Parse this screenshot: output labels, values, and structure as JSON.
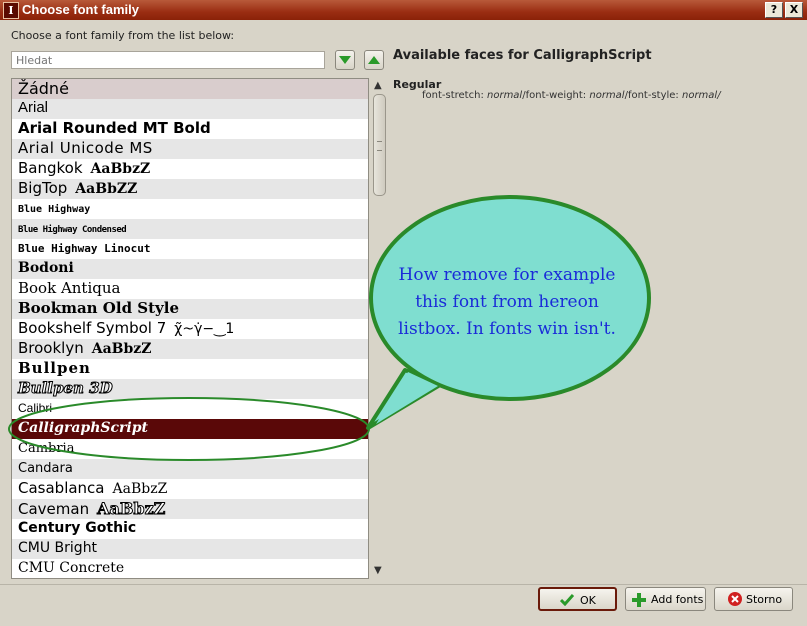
{
  "window": {
    "title": "Choose font family",
    "help_button": "?",
    "close_button": "X"
  },
  "prompt": "Choose a font family from the list below:",
  "search": {
    "placeholder": "Hledat"
  },
  "faces": {
    "title": "Available faces for CalligraphScript",
    "items": [
      {
        "name": "Regular",
        "stretch_label": "font-stretch: ",
        "stretch": "normal",
        "weight_label": "/font-weight: ",
        "weight": "normal",
        "style_label": "/font-style: ",
        "style": "normal/"
      }
    ]
  },
  "font_list": [
    {
      "name": "Žádné",
      "sample": ""
    },
    {
      "name": "Arial",
      "sample": ""
    },
    {
      "name": "Arial Rounded MT Bold",
      "sample": ""
    },
    {
      "name": "Arial Unicode MS",
      "sample": ""
    },
    {
      "name": "Bangkok",
      "sample": "AaBbzZ"
    },
    {
      "name": "BigTop",
      "sample": "AaBbZZ"
    },
    {
      "name": "Blue Highway",
      "sample": ""
    },
    {
      "name": "Blue Highway Condensed",
      "sample": ""
    },
    {
      "name": "Blue Highway Linocut",
      "sample": ""
    },
    {
      "name": "Bodoni",
      "sample": ""
    },
    {
      "name": "Book Antiqua",
      "sample": ""
    },
    {
      "name": "Bookman Old Style",
      "sample": ""
    },
    {
      "name": "Bookshelf Symbol 7",
      "sample": "χ̃~γ̇−‿1"
    },
    {
      "name": "Brooklyn",
      "sample": "AaBbzZ"
    },
    {
      "name": "Bullpen",
      "sample": ""
    },
    {
      "name": "Bullpen 3D",
      "sample": ""
    },
    {
      "name": "Calibri",
      "sample": ""
    },
    {
      "name": "CalligraphScript",
      "sample": ""
    },
    {
      "name": "Cambria",
      "sample": ""
    },
    {
      "name": "Candara",
      "sample": ""
    },
    {
      "name": "Casablanca",
      "sample": "AaBbzZ"
    },
    {
      "name": "Caveman",
      "sample": "AaBbzZ"
    },
    {
      "name": "Century Gothic",
      "sample": ""
    },
    {
      "name": "CMU Bright",
      "sample": ""
    },
    {
      "name": "CMU Concrete",
      "sample": ""
    }
  ],
  "selected_font": "CalligraphScript",
  "annotation": {
    "text": "How remove for example this font from hereon listbox. In fonts win isn't.",
    "lines": [
      "How remove for example",
      "this font from hereon",
      "listbox. In fonts win isn't."
    ]
  },
  "buttons": {
    "ok": "OK",
    "add_fonts": "Add fonts",
    "cancel": "Storno"
  },
  "colors": {
    "titlebar": "#9a2d12",
    "selection": "#5a0808",
    "bubble_fill": "#7fded0",
    "bubble_border": "#2a8a2a",
    "callout_text": "#1a2bd8",
    "arrow_green": "#2a9a2a"
  }
}
